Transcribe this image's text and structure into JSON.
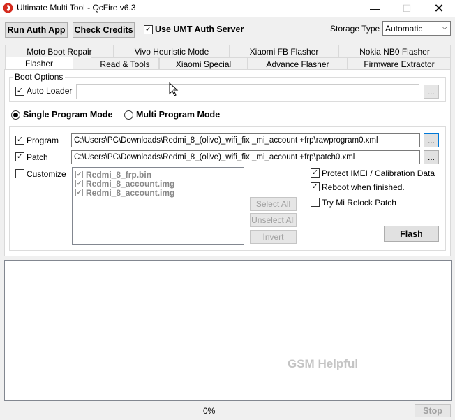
{
  "window": {
    "title": "Ultimate Multi Tool - QcFire v6.3",
    "icon": "qualcomm-snapdragon-icon",
    "controls": [
      "minimize-icon",
      "maximize-icon",
      "close-icon"
    ]
  },
  "toolbar": {
    "run_auth_label": "Run Auth App",
    "check_credits_label": "Check Credits",
    "use_umt_auth_label": "Use UMT Auth Server",
    "use_umt_auth_checked": true,
    "storage_type_label": "Storage Type",
    "storage_type_value": "Automatic"
  },
  "tabs": {
    "row1": [
      "Moto Boot Repair",
      "Vivo Heuristic Mode",
      "Xiaomi FB Flasher",
      "Nokia NB0 Flasher"
    ],
    "row2": [
      "Flasher",
      "Read & Tools",
      "Xiaomi Special",
      "Advance Flasher",
      "Firmware Extractor"
    ],
    "active": "Flasher"
  },
  "boot_options": {
    "legend": "Boot Options",
    "auto_loader_label": "Auto Loader",
    "auto_loader_checked": true,
    "loader_path": "",
    "browse_label": "..."
  },
  "mode": {
    "single_label": "Single Program Mode",
    "multi_label": "Multi Program Mode",
    "selected": "single"
  },
  "files": {
    "program_label": "Program",
    "program_checked": true,
    "program_path": "C:\\Users\\PC\\Downloads\\Redmi_8_(olive)_wifi_fix _mi_account +frp\\rawprogram0.xml",
    "patch_label": "Patch",
    "patch_checked": true,
    "patch_path": "C:\\Users\\PC\\Downloads\\Redmi_8_(olive)_wifi_fix _mi_account +frp\\patch0.xml",
    "browse_label": "..."
  },
  "customize": {
    "label": "Customize",
    "checked": false,
    "items": [
      "Redmi_8_frp.bin",
      "Redmi_8_account.img",
      "Redmi_8_account.img"
    ],
    "select_all_label": "Select All",
    "unselect_all_label": "Unselect All",
    "invert_label": "Invert"
  },
  "options": {
    "protect_imei_label": "Protect IMEI / Calibration Data",
    "protect_imei_checked": true,
    "reboot_label": "Reboot when finished.",
    "reboot_checked": true,
    "relock_label": "Try Mi Relock Patch",
    "relock_checked": false,
    "flash_label": "Flash"
  },
  "log": {
    "watermark": "GSM Helpful"
  },
  "status": {
    "progress_text": "0%",
    "progress_value": 0,
    "stop_label": "Stop"
  }
}
